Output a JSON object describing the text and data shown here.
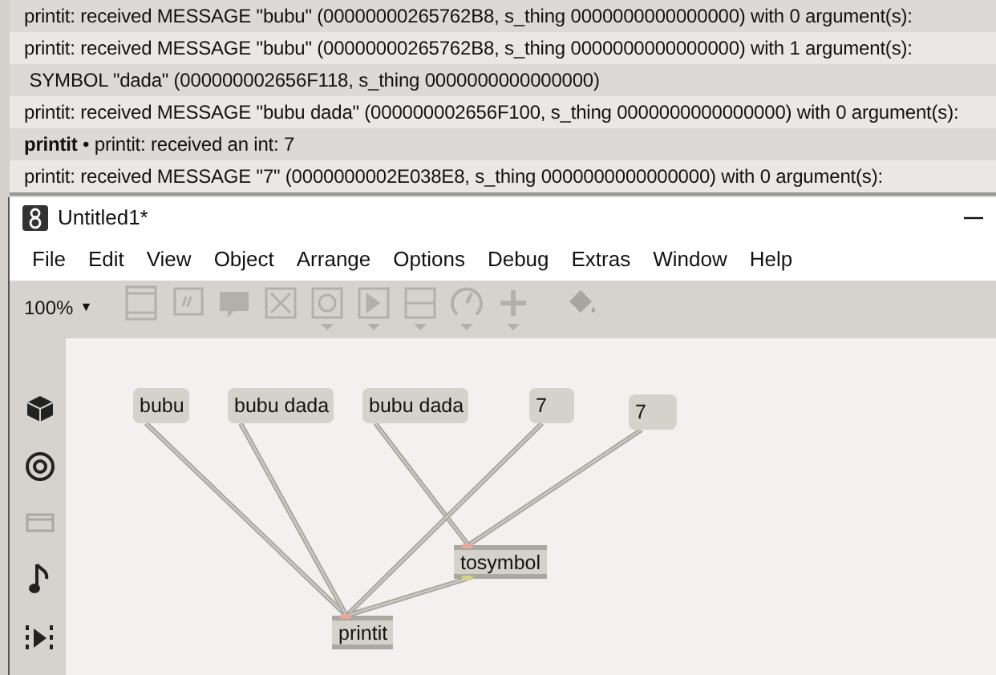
{
  "console": {
    "lines": [
      {
        "text": "printit: received MESSAGE \"bubu\" (00000000265762B8, s_thing 0000000000000000) with 0 argument(s):"
      },
      {
        "text": "printit: received MESSAGE \"bubu\" (00000000265762B8, s_thing 0000000000000000) with 1 argument(s):"
      },
      {
        "text": " SYMBOL \"dada\" (000000002656F118, s_thing 0000000000000000)"
      },
      {
        "text": "printit: received MESSAGE \"bubu dada\" (000000002656F100, s_thing 0000000000000000) with 0 argument(s):"
      },
      {
        "text": "**printit** • printit: received an int: 7"
      },
      {
        "text": "printit: received MESSAGE \"7\" (0000000002E038E8, s_thing 0000000000000000) with 0 argument(s):"
      }
    ]
  },
  "window": {
    "title": "Untitled1*",
    "menu": [
      "File",
      "Edit",
      "View",
      "Object",
      "Arrange",
      "Options",
      "Debug",
      "Extras",
      "Window",
      "Help"
    ],
    "toolbar": {
      "zoom": "100%",
      "zoom_caret": "▼"
    },
    "patch": {
      "boxes": [
        {
          "kind": "message",
          "text": "bubu"
        },
        {
          "kind": "message",
          "text": "bubu dada"
        },
        {
          "kind": "message",
          "text": "bubu dada"
        },
        {
          "kind": "message",
          "text": "7"
        },
        {
          "kind": "message",
          "text": "7"
        },
        {
          "kind": "object",
          "text": "tosymbol"
        },
        {
          "kind": "object",
          "text": "printit"
        }
      ]
    }
  }
}
